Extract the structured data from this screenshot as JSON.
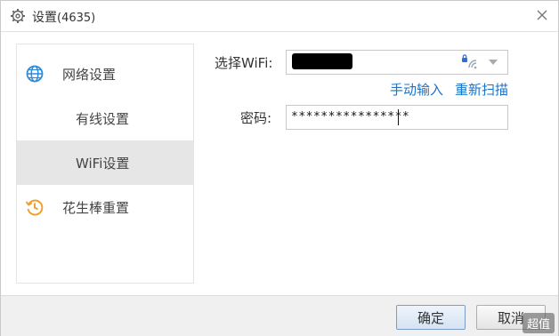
{
  "window": {
    "title": "设置",
    "title_count": "(4635)"
  },
  "sidebar": {
    "items": [
      {
        "label": "网络设置",
        "icon": "globe-icon"
      },
      {
        "label": "有线设置"
      },
      {
        "label": "WiFi设置",
        "selected": true
      },
      {
        "label": "花生棒重置",
        "icon": "history-icon"
      }
    ]
  },
  "form": {
    "wifi_label": "选择WiFi:",
    "wifi_value": "",
    "manual_input": "手动输入",
    "rescan": "重新扫描",
    "password_label": "密码:",
    "password_value": "****************"
  },
  "footer": {
    "ok": "确定",
    "cancel": "取消"
  },
  "watermark": "超值",
  "colors": {
    "link": "#1a73c9",
    "sidebar_selected": "#e6e6e6",
    "globe_icon": "#2f8ad8",
    "history_icon": "#f0a030"
  }
}
